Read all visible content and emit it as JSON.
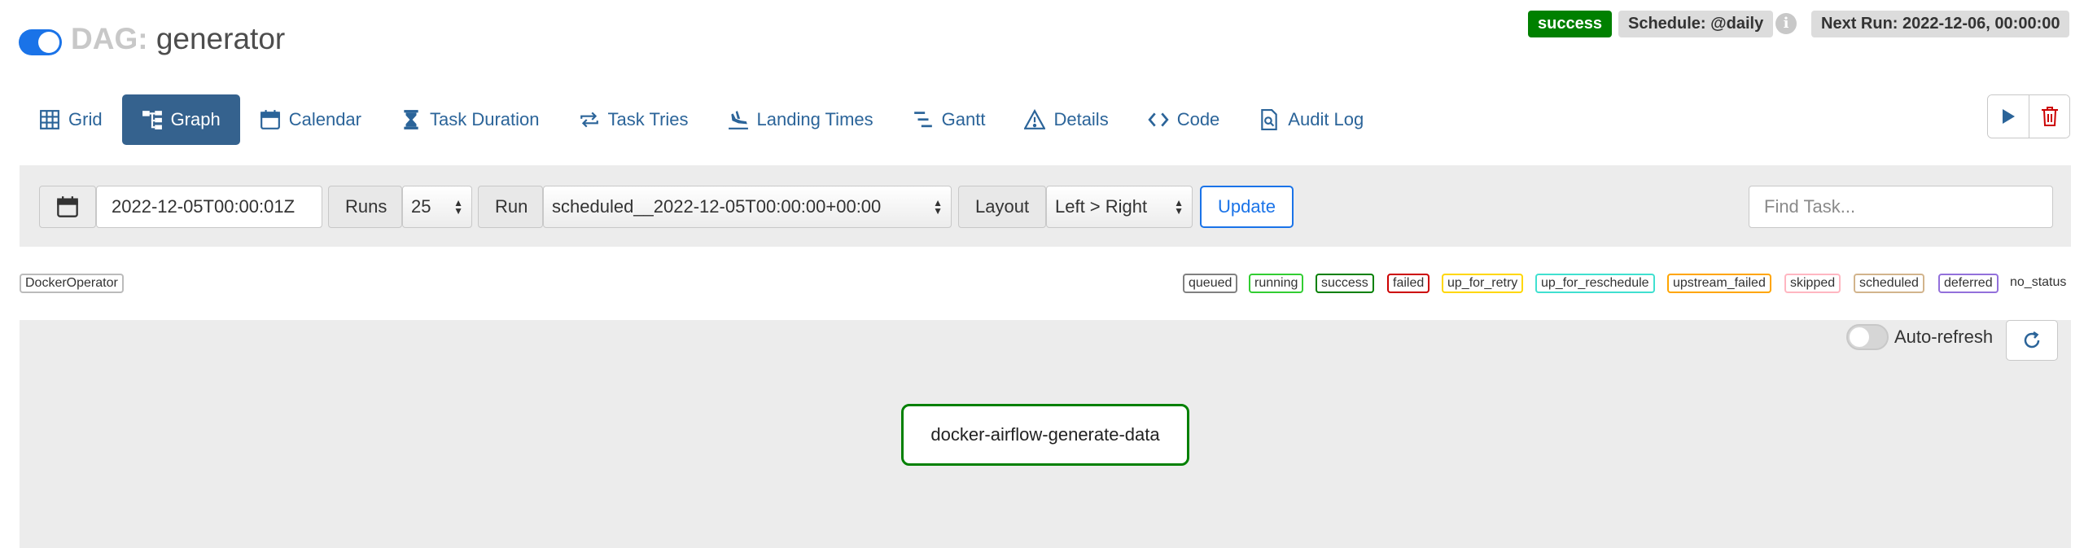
{
  "header": {
    "dag_prefix": "DAG:",
    "dag_name": "generator",
    "status_badge": "success",
    "schedule": "Schedule: @daily",
    "next_run": "Next Run: 2022-12-06, 00:00:00"
  },
  "tabs": [
    {
      "label": "Grid",
      "icon": "grid-icon"
    },
    {
      "label": "Graph",
      "icon": "graph-icon",
      "active": true
    },
    {
      "label": "Calendar",
      "icon": "calendar-icon"
    },
    {
      "label": "Task Duration",
      "icon": "hourglass-icon"
    },
    {
      "label": "Task Tries",
      "icon": "retry-icon"
    },
    {
      "label": "Landing Times",
      "icon": "landing-icon"
    },
    {
      "label": "Gantt",
      "icon": "gantt-icon"
    },
    {
      "label": "Details",
      "icon": "warning-triangle-icon"
    },
    {
      "label": "Code",
      "icon": "code-icon"
    },
    {
      "label": "Audit Log",
      "icon": "audit-log-icon"
    }
  ],
  "controls": {
    "base_date": "2022-12-05T00:00:01Z",
    "runs_label": "Runs",
    "runs_value": "25",
    "run_label": "Run",
    "run_value": "scheduled__2022-12-05T00:00:00+00:00",
    "layout_label": "Layout",
    "layout_value": "Left > Right",
    "update_label": "Update",
    "find_task_placeholder": "Find Task..."
  },
  "legend": {
    "operator": "DockerOperator",
    "states": [
      {
        "label": "queued",
        "color": "#808080"
      },
      {
        "label": "running",
        "color": "#32cd32"
      },
      {
        "label": "success",
        "color": "#008000"
      },
      {
        "label": "failed",
        "color": "#cc0000"
      },
      {
        "label": "up_for_retry",
        "color": "#ffd700"
      },
      {
        "label": "up_for_reschedule",
        "color": "#40e0d0"
      },
      {
        "label": "upstream_failed",
        "color": "#ffa500"
      },
      {
        "label": "skipped",
        "color": "#ffb6c1"
      },
      {
        "label": "scheduled",
        "color": "#d2b48c"
      },
      {
        "label": "deferred",
        "color": "#9370db"
      }
    ],
    "no_status": "no_status"
  },
  "graph": {
    "auto_refresh_label": "Auto-refresh",
    "task_label": "docker-airflow-generate-data"
  },
  "colors": {
    "accent": "#1a73e8",
    "active_tab": "#35628e",
    "success": "#008000",
    "danger": "#cc0000"
  }
}
